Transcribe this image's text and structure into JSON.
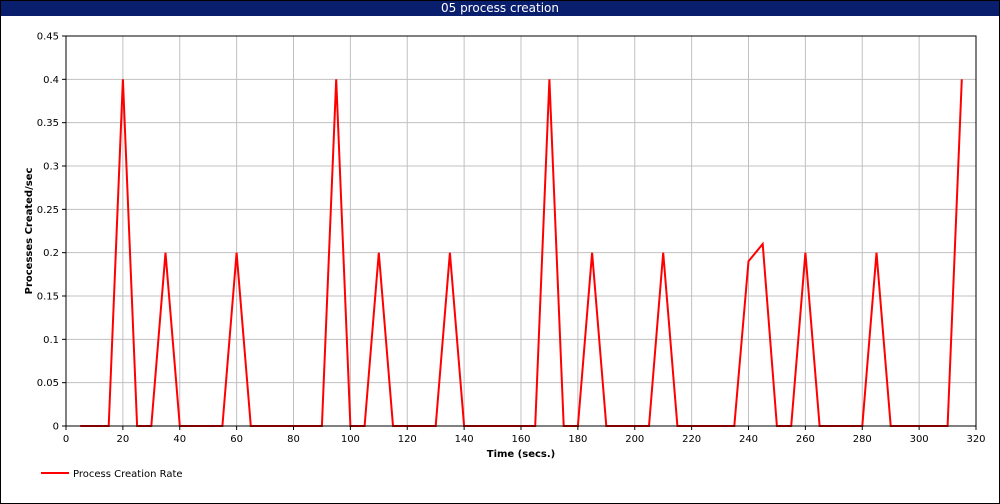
{
  "window": {
    "title": "05 process creation"
  },
  "colors": {
    "title_bar": "#0a1e6e",
    "series": "#ff0000",
    "grid": "#c0c0c0"
  },
  "chart_data": {
    "type": "line",
    "title": "05 process creation",
    "xlabel": "Time (secs.)",
    "ylabel": "Processes Created/sec",
    "xlim": [
      0,
      320
    ],
    "ylim": [
      0,
      0.45
    ],
    "x_ticks": [
      0,
      20,
      40,
      60,
      80,
      100,
      120,
      140,
      160,
      180,
      200,
      220,
      240,
      260,
      280,
      300,
      320
    ],
    "y_ticks": [
      0,
      0.05,
      0.1,
      0.15,
      0.2,
      0.25,
      0.3,
      0.35,
      0.4,
      0.45
    ],
    "x_tick_labels": [
      "0",
      "20",
      "40",
      "60",
      "80",
      "100",
      "120",
      "140",
      "160",
      "180",
      "200",
      "220",
      "240",
      "260",
      "280",
      "300",
      "320"
    ],
    "y_tick_labels": [
      "0",
      "0.05",
      "0.1",
      "0.15",
      "0.2",
      "0.25",
      "0.3",
      "0.35",
      "0.4",
      "0.45"
    ],
    "grid": true,
    "legend_position": "bottom-left",
    "series": [
      {
        "name": "Process Creation Rate",
        "color": "#ff0000",
        "x": [
          5,
          10,
          15,
          20,
          25,
          30,
          35,
          40,
          45,
          50,
          55,
          60,
          65,
          70,
          75,
          80,
          85,
          90,
          95,
          100,
          105,
          110,
          115,
          120,
          125,
          130,
          135,
          140,
          145,
          150,
          155,
          160,
          165,
          170,
          175,
          180,
          185,
          190,
          195,
          200,
          205,
          210,
          215,
          220,
          225,
          230,
          235,
          240,
          245,
          250,
          255,
          260,
          265,
          270,
          275,
          280,
          285,
          290,
          295,
          300,
          305,
          310,
          315
        ],
        "y": [
          0,
          0,
          0,
          0.4,
          0,
          0,
          0.2,
          0,
          0,
          0,
          0,
          0.2,
          0,
          0,
          0,
          0,
          0,
          0,
          0.4,
          0,
          0,
          0.2,
          0,
          0,
          0,
          0,
          0.2,
          0,
          0,
          0,
          0,
          0,
          0,
          0.4,
          0,
          0,
          0.2,
          0,
          0,
          0,
          0,
          0.2,
          0,
          0,
          0,
          0,
          0,
          0.19,
          0.21,
          0,
          0,
          0.2,
          0,
          0,
          0,
          0,
          0.2,
          0,
          0,
          0,
          0,
          0,
          0.4
        ]
      }
    ]
  }
}
